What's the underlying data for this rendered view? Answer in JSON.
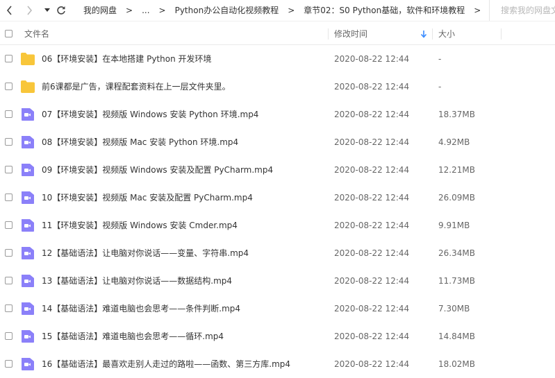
{
  "toolbar": {
    "back_icon": "chevron-left-icon",
    "forward_icon": "chevron-right-icon",
    "dropdown_icon": "caret-down-icon",
    "refresh_icon": "refresh-icon"
  },
  "breadcrumb": {
    "items": [
      "我的网盘",
      "...",
      "Python办公自动化视频教程",
      "章节02：S0 Python基础，软件和环境教程"
    ],
    "separator": ">"
  },
  "search": {
    "placeholder": "搜索我的网盘文件"
  },
  "table": {
    "columns": {
      "name": "文件名",
      "modified": "修改时间",
      "size": "大小"
    },
    "sort_icon": "arrow-down-icon",
    "sort_color": "#3b8cff",
    "rows": [
      {
        "type": "folder",
        "name": "06【环境安装】在本地搭建 Python 开发环境",
        "modified": "2020-08-22 12:44",
        "size": "-"
      },
      {
        "type": "folder",
        "name": "前6课都是广告，课程配套资料在上一层文件夹里。",
        "modified": "2020-08-22 12:44",
        "size": "-"
      },
      {
        "type": "video",
        "name": "07【环境安装】视频版 Windows 安装 Python 环境.mp4",
        "modified": "2020-08-22 12:44",
        "size": "18.37MB"
      },
      {
        "type": "video",
        "name": "08【环境安装】视频版 Mac 安装 Python 环境.mp4",
        "modified": "2020-08-22 12:44",
        "size": "4.92MB"
      },
      {
        "type": "video",
        "name": "09【环境安装】视频版 Windows 安装及配置 PyCharm.mp4",
        "modified": "2020-08-22 12:44",
        "size": "12.21MB"
      },
      {
        "type": "video",
        "name": "10【环境安装】视频版 Mac 安装及配置 PyCharm.mp4",
        "modified": "2020-08-22 12:44",
        "size": "26.09MB"
      },
      {
        "type": "video",
        "name": "11【环境安装】视频版 Windows 安装 Cmder.mp4",
        "modified": "2020-08-22 12:44",
        "size": "9.91MB"
      },
      {
        "type": "video",
        "name": "12【基础语法】让电脑对你说话——变量、字符串.mp4",
        "modified": "2020-08-22 12:44",
        "size": "26.34MB"
      },
      {
        "type": "video",
        "name": "13【基础语法】让电脑对你说话——数据结构.mp4",
        "modified": "2020-08-22 12:44",
        "size": "11.73MB"
      },
      {
        "type": "video",
        "name": "14【基础语法】难道电脑也会思考——条件判断.mp4",
        "modified": "2020-08-22 12:44",
        "size": "7.30MB"
      },
      {
        "type": "video",
        "name": "15【基础语法】难道电脑也会思考——循环.mp4",
        "modified": "2020-08-22 12:44",
        "size": "14.84MB"
      },
      {
        "type": "video",
        "name": "16【基础语法】最喜欢走别人走过的路啦——函数、第三方库.mp4",
        "modified": "2020-08-22 12:44",
        "size": "18.02MB"
      }
    ]
  },
  "colors": {
    "folder": "#f8c63a",
    "video": "#8b80f9"
  }
}
